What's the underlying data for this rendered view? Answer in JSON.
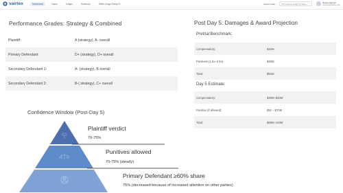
{
  "topbar": {
    "logo": "vairtex",
    "nav": [
      "Dashboard",
      "Cases",
      "Judges",
      "Summary",
      "Settle-Judge Ready KI"
    ],
    "active_index": 0,
    "link": "Search Case",
    "search": "Find Case or Judge by Name",
    "user_name": "Susan Carmen",
    "user_email": "scarmen@vairtex.com"
  },
  "grades": {
    "title": "Performance Grades: Strategy & Combined",
    "rows": [
      {
        "label": "Plaintiff:",
        "value": "A (strategy), A- overall"
      },
      {
        "label": "Primary Defendant:",
        "value": "D+ (strategy), D+ overall"
      },
      {
        "label": "Secondary Defendant 1:",
        "value": "A- (strategy), B overall"
      },
      {
        "label": "Secondary Defendant 2:",
        "value": "B-( strategy), C+ overall"
      }
    ]
  },
  "damages": {
    "title": "Post Day 5:  Damages & Award Projection",
    "pretrial_head": "Pretrial Benchmark:",
    "pretrial": [
      {
        "label": "Compensatory:",
        "value": "$22M"
      },
      {
        "label": "Punitives (1.5x–2.5x):",
        "value": "$30M"
      },
      {
        "label": "Total:",
        "value": "$52M"
      }
    ],
    "estimate_head": "Day 5 Estimate:",
    "estimate": [
      {
        "label": "Compensatory:",
        "value": "$26M–$30M"
      },
      {
        "label": "Punitive (if allowed):",
        "value": "$52 – $70M"
      },
      {
        "label": "Total:",
        "value": "$68M–100M"
      }
    ]
  },
  "confidence": {
    "title": "Confidence Window (Post-Day 5)",
    "tiers": [
      {
        "title": "Plaintiff verdict",
        "detail": "70-75%",
        "icon": "gavel-icon"
      },
      {
        "title": "Punitives allowed",
        "detail": "70-75% (steady)",
        "icon": "scale-icon"
      },
      {
        "title": "Primary Defendant  ≥60% share",
        "detail": "75% (decreased because of increased attention on other parties)",
        "icon": "people-icon"
      }
    ],
    "colors": {
      "top": "#4d6faf",
      "mid": "#5d8bc9",
      "bottom": "#7fa3d7"
    }
  }
}
